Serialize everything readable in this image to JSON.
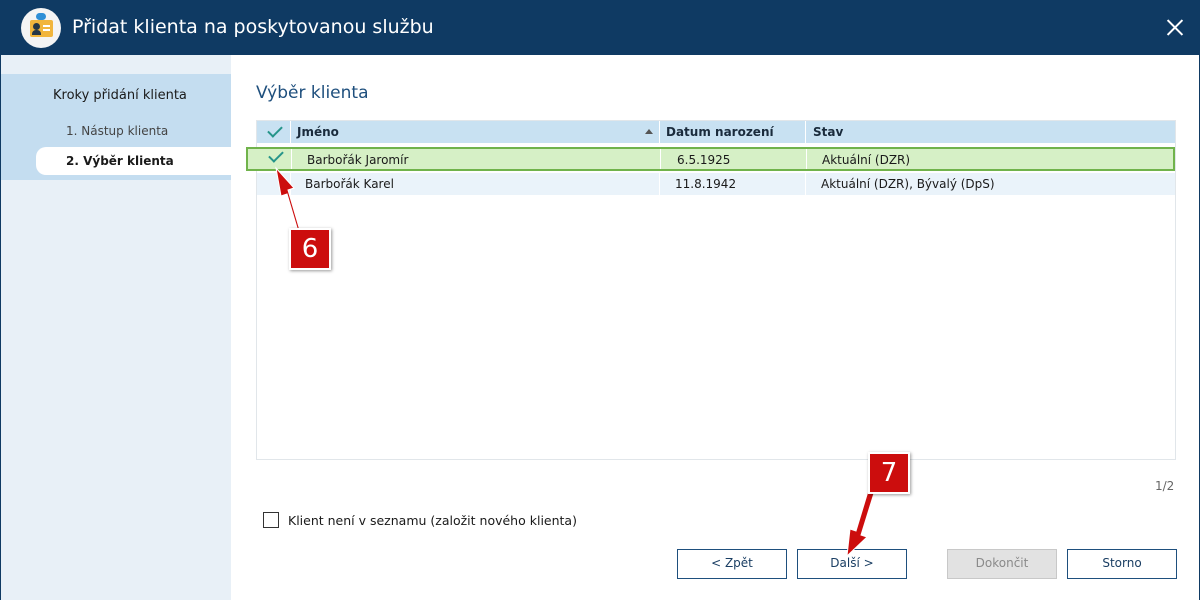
{
  "window": {
    "title": "Přidat klienta na poskytovanou službu",
    "icon": "client-card-icon",
    "close_icon": "close-icon"
  },
  "sidebar": {
    "heading": "Kroky přidání klienta",
    "steps": [
      {
        "label": "1. Nástup klienta",
        "active": false
      },
      {
        "label": "2. Výběr klienta",
        "active": true
      }
    ]
  },
  "main": {
    "title": "Výběr klienta",
    "grid": {
      "columns": [
        "Jméno",
        "Datum narození",
        "Stav"
      ],
      "sort_column": "Jméno",
      "sort_direction": "ascending",
      "rows": [
        {
          "checked": true,
          "name": "Barbořák Jaromír",
          "dob": "6.5.1925",
          "status": "Aktuální (DZR)",
          "selected": true
        },
        {
          "checked": false,
          "name": "Barbořák Karel",
          "dob": "11.8.1942",
          "status": "Aktuální (DZR), Bývalý (DpS)",
          "selected": false
        }
      ]
    },
    "pager": "1/2",
    "new_client_checkbox": {
      "label": "Klient není v seznamu (založit nového klienta)",
      "checked": false
    }
  },
  "buttons": {
    "back": "< Zpět",
    "next": "Další >",
    "finish": "Dokončit",
    "cancel": "Storno"
  },
  "annotations": {
    "callout_6": "6",
    "callout_7": "7"
  },
  "colors": {
    "titlebar": "#0f3a63",
    "accent": "#1e4f7d",
    "selected_row": "#d6f0c6",
    "selected_border": "#70b34b",
    "check": "#26958a",
    "callout": "#cc0d0d"
  }
}
